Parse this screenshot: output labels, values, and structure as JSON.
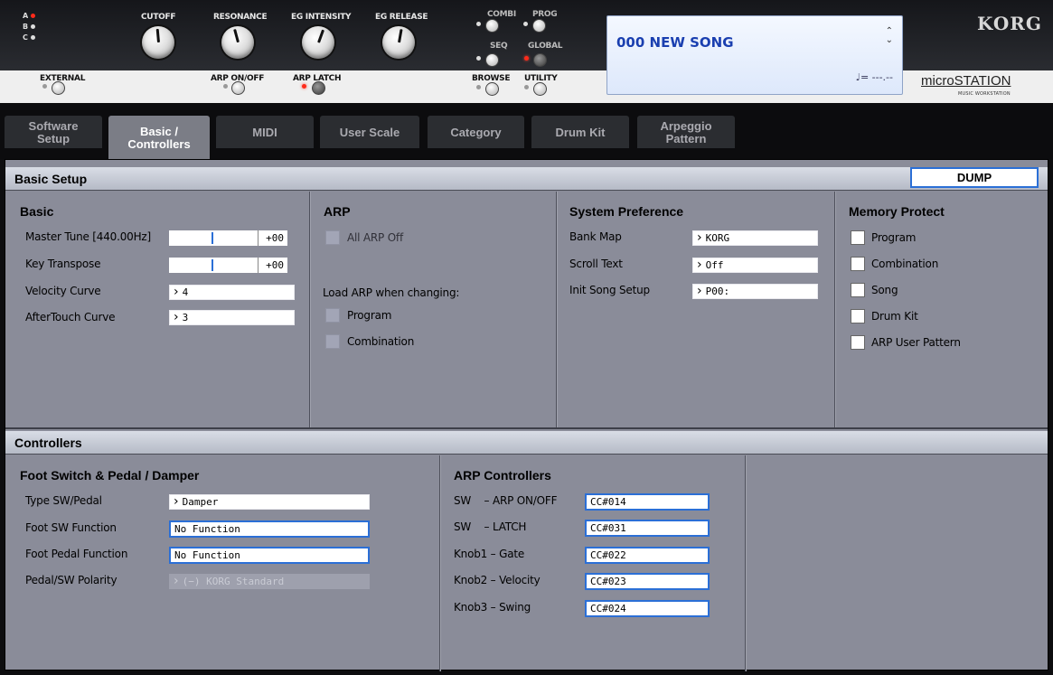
{
  "hardware": {
    "bank_leds": [
      {
        "label": "A",
        "on": true
      },
      {
        "label": "B",
        "on": false
      },
      {
        "label": "C",
        "on": false
      }
    ],
    "knobs": [
      "CUTOFF",
      "RESONANCE",
      "EG INTENSITY",
      "EG RELEASE"
    ],
    "external_label": "EXTERNAL",
    "arp_onoff_label": "ARP ON/OFF",
    "arp_latch_label": "ARP LATCH",
    "mode_buttons": {
      "combi": "COMBI",
      "prog": "PROG",
      "seq": "SEQ",
      "global": "GLOBAL",
      "browse": "BROWSE",
      "utility": "UTILITY"
    },
    "display": {
      "song": "000 NEW SONG",
      "tempo": "♩= ---.--"
    },
    "brand": "KORG",
    "model": "microSTATION",
    "model_sub": "MUSIC WORKSTATION",
    "colors": {
      "led_active": "#ff2a1a",
      "display_text": "#1a3fb0"
    }
  },
  "tabs": [
    {
      "label": "Software Setup",
      "active": false
    },
    {
      "label": "Basic / Controllers",
      "active": true
    },
    {
      "label": "MIDI",
      "active": false
    },
    {
      "label": "User Scale",
      "active": false
    },
    {
      "label": "Category",
      "active": false
    },
    {
      "label": "Drum Kit",
      "active": false
    },
    {
      "label": "Arpeggio Pattern",
      "active": false
    }
  ],
  "basic_setup": {
    "header": "Basic Setup",
    "dump_label": "DUMP",
    "basic": {
      "title": "Basic",
      "master_tune_label": "Master Tune [440.00Hz]",
      "master_tune_value": "+00",
      "key_transpose_label": "Key Transpose",
      "key_transpose_value": "+00",
      "velocity_curve_label": "Velocity Curve",
      "velocity_curve_value": "4",
      "aftertouch_curve_label": "AfterTouch Curve",
      "aftertouch_curve_value": "3"
    },
    "arp": {
      "title": "ARP",
      "all_arp_off_label": "All ARP Off",
      "load_arp_label": "Load ARP when changing:",
      "program_label": "Program",
      "combination_label": "Combination"
    },
    "system_preference": {
      "title": "System Preference",
      "bank_map_label": "Bank Map",
      "bank_map_value": "KORG",
      "scroll_text_label": "Scroll Text",
      "scroll_text_value": "Off",
      "init_song_label": "Init Song Setup",
      "init_song_value": "P00:"
    },
    "memory_protect": {
      "title": "Memory Protect",
      "items": [
        "Program",
        "Combination",
        "Song",
        "Drum Kit",
        "ARP User Pattern"
      ]
    }
  },
  "controllers": {
    "header": "Controllers",
    "foot": {
      "title": "Foot Switch & Pedal / Damper",
      "type_label": "Type SW/Pedal",
      "type_value": "Damper",
      "foot_sw_label": "Foot SW Function",
      "foot_sw_value": "No Function",
      "foot_pedal_label": "Foot Pedal Function",
      "foot_pedal_value": "No Function",
      "polarity_label": "Pedal/SW Polarity",
      "polarity_value": "(−) KORG Standard"
    },
    "arp_controllers": {
      "title": "ARP Controllers",
      "rows": [
        {
          "label": "SW    – ARP ON/OFF",
          "value": "CC#014"
        },
        {
          "label": "SW    – LATCH",
          "value": "CC#031"
        },
        {
          "label": "Knob1 – Gate",
          "value": "CC#022"
        },
        {
          "label": "Knob2 – Velocity",
          "value": "CC#023"
        },
        {
          "label": "Knob3 – Swing",
          "value": "CC#024"
        }
      ]
    }
  }
}
